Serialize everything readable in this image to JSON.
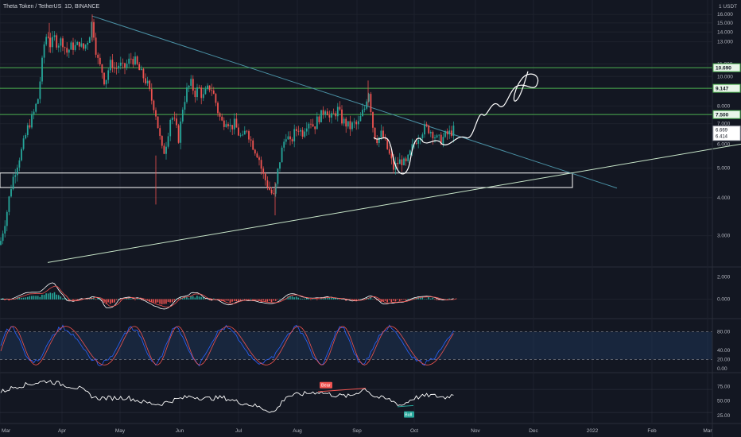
{
  "header": {
    "symbol": "Theta Token / TetherUS, 1D, BINANCE"
  },
  "colors": {
    "background": "#131722",
    "grid": "#1e222d",
    "axis_text": "#b2b5be",
    "up": "#26a69a",
    "down": "#ef5350",
    "hline": "#4caf50",
    "trend_down": "#4a90a4",
    "trend_up": "#c8e6c9",
    "drawing": "#ffffff",
    "stoch_k": "#2962ff",
    "stoch_d": "#ef5350",
    "rsi_line": "#ffffff"
  },
  "chart_data": [
    {
      "type": "candlestick",
      "pane": "price",
      "unit_label": "1 USDT",
      "y_ticks": [
        "16.000",
        "15.000",
        "14.000",
        "13.000",
        "11.000",
        "10.000",
        "8.000",
        "7.000",
        "6.000",
        "5.000",
        "4.000",
        "3.000"
      ],
      "ylim": [
        2.5,
        17
      ],
      "x_ticks": [
        "Mar",
        "Apr",
        "May",
        "Jun",
        "Jul",
        "Aug",
        "Sep",
        "Oct",
        "Nov",
        "Dec",
        "2022",
        "Feb",
        "Mar"
      ],
      "horizontal_levels": [
        10.69,
        9.147,
        7.5
      ],
      "level_labels": [
        "10.690",
        "9.147",
        "7.500"
      ],
      "last_price_labels": [
        "6.669",
        "6.414"
      ],
      "support_zone": [
        4.32,
        4.82
      ],
      "close_path": [
        [
          0,
          2.8
        ],
        [
          8,
          3.5
        ],
        [
          15,
          4.5
        ],
        [
          22,
          5.2
        ],
        [
          28,
          5.8
        ],
        [
          35,
          6.8
        ],
        [
          42,
          7.5
        ],
        [
          48,
          8.5
        ],
        [
          52,
          10.5
        ],
        [
          56,
          13
        ],
        [
          60,
          14
        ],
        [
          64,
          12.5
        ],
        [
          68,
          13.5
        ],
        [
          72,
          12.8
        ],
        [
          78,
          13.2
        ],
        [
          84,
          12
        ],
        [
          90,
          12.6
        ],
        [
          96,
          12.5
        ],
        [
          100,
          13
        ],
        [
          104,
          12.2
        ],
        [
          108,
          12.8
        ],
        [
          112,
          13.5
        ],
        [
          116,
          15.2
        ],
        [
          120,
          12.5
        ],
        [
          124,
          11
        ],
        [
          128,
          10.5
        ],
        [
          132,
          9.5
        ],
        [
          136,
          10.5
        ],
        [
          140,
          11.2
        ],
        [
          145,
          10.5
        ],
        [
          150,
          11
        ],
        [
          155,
          10.6
        ],
        [
          160,
          11
        ],
        [
          165,
          11.5
        ],
        [
          170,
          11.2
        ],
        [
          175,
          10.5
        ],
        [
          180,
          10
        ],
        [
          185,
          9.5
        ],
        [
          190,
          8.5
        ],
        [
          195,
          7.8
        ],
        [
          200,
          6.5
        ],
        [
          205,
          5.5
        ],
        [
          210,
          6.2
        ],
        [
          215,
          7.5
        ],
        [
          220,
          7
        ],
        [
          225,
          6.2
        ],
        [
          230,
          8
        ],
        [
          235,
          9
        ],
        [
          240,
          9.5
        ],
        [
          245,
          8.8
        ],
        [
          250,
          9.2
        ],
        [
          255,
          8.5
        ],
        [
          260,
          9
        ],
        [
          265,
          9.3
        ],
        [
          270,
          8.5
        ],
        [
          275,
          7.5
        ],
        [
          280,
          7
        ],
        [
          285,
          7.3
        ],
        [
          290,
          6.8
        ],
        [
          295,
          7
        ],
        [
          300,
          6.5
        ],
        [
          305,
          6.2
        ],
        [
          310,
          6.8
        ],
        [
          315,
          6.2
        ],
        [
          320,
          5.8
        ],
        [
          325,
          5.5
        ],
        [
          330,
          4.8
        ],
        [
          335,
          4.5
        ],
        [
          340,
          4.2
        ],
        [
          345,
          4.0
        ],
        [
          350,
          5
        ],
        [
          355,
          5.8
        ],
        [
          360,
          6.5
        ],
        [
          365,
          6
        ],
        [
          370,
          6.5
        ],
        [
          375,
          6.8
        ],
        [
          380,
          6.5
        ],
        [
          385,
          7
        ],
        [
          390,
          7.2
        ],
        [
          395,
          6.8
        ],
        [
          400,
          7.3
        ],
        [
          405,
          7.5
        ],
        [
          410,
          8
        ],
        [
          415,
          7.2
        ],
        [
          420,
          7.5
        ],
        [
          425,
          7.8
        ],
        [
          430,
          7.2
        ],
        [
          435,
          7
        ],
        [
          440,
          6.8
        ],
        [
          445,
          7
        ],
        [
          450,
          6.9
        ],
        [
          455,
          7.5
        ],
        [
          460,
          8
        ],
        [
          463,
          9.3
        ],
        [
          466,
          8
        ],
        [
          470,
          6.5
        ],
        [
          475,
          6.2
        ],
        [
          480,
          6.5
        ],
        [
          485,
          6.0
        ],
        [
          490,
          5.5
        ],
        [
          495,
          5.0
        ],
        [
          500,
          5.2
        ],
        [
          505,
          5.3
        ],
        [
          510,
          5.1
        ],
        [
          515,
          5.5
        ],
        [
          520,
          6.0
        ],
        [
          525,
          6.3
        ],
        [
          530,
          6.6
        ],
        [
          535,
          6.8
        ],
        [
          540,
          6.7
        ],
        [
          545,
          6.5
        ],
        [
          550,
          6.2
        ],
        [
          555,
          6.2
        ],
        [
          560,
          6.4
        ],
        [
          565,
          6.5
        ],
        [
          570,
          6.67
        ]
      ]
    },
    {
      "type": "line",
      "pane": "macd",
      "y_ticks": [
        "2.000",
        "0.000"
      ]
    },
    {
      "type": "line",
      "pane": "stoch_rsi",
      "y_ticks": [
        "80.00",
        "40.00",
        "20.00",
        "0.00"
      ]
    },
    {
      "type": "line",
      "pane": "rsi",
      "y_ticks": [
        "75.00",
        "50.00",
        "25.00"
      ],
      "annotations": [
        "Bear",
        "Bull"
      ]
    }
  ]
}
